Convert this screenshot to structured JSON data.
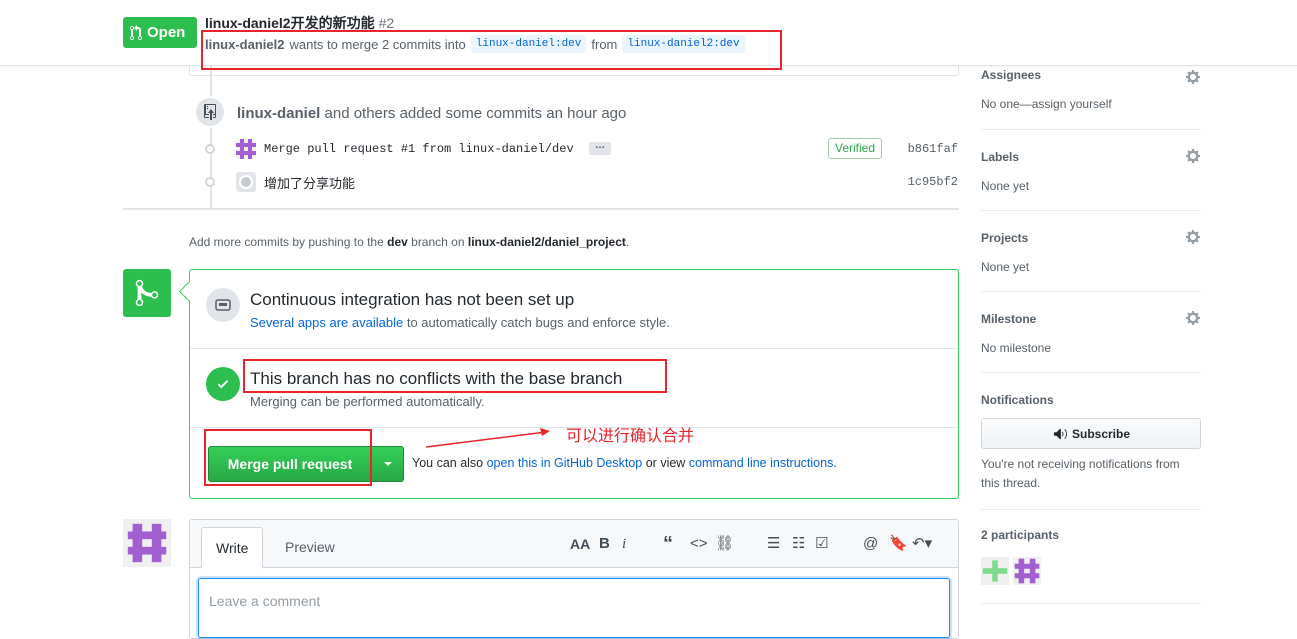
{
  "header": {
    "state": "Open",
    "title": "linux-daniel2开发的新功能",
    "number": "#2",
    "author": "linux-daniel2",
    "merge_text": "wants to merge 2 commits into",
    "base_branch": "linux-daniel:dev",
    "from_text": "from",
    "head_branch": "linux-daniel2:dev"
  },
  "timeline": {
    "summary_author": "linux-daniel",
    "summary_text": "and others added some commits an hour ago",
    "commits": [
      {
        "message": "Merge pull request #1 from linux-daniel/dev",
        "verified": "Verified",
        "sha": "b861faf",
        "ellipsis": "…"
      },
      {
        "message": "增加了分享功能",
        "sha": "1c95bf2"
      }
    ],
    "add_more_prefix": "Add more commits by pushing to the",
    "add_more_branch": "dev",
    "add_more_mid": "branch on",
    "add_more_repo": "linux-daniel2/daniel_project",
    "add_more_suffix": "."
  },
  "merge_box": {
    "ci_title": "Continuous integration has not been set up",
    "ci_link": "Several apps are available",
    "ci_text": "to automatically catch bugs and enforce style.",
    "conflict_title": "This branch has no conflicts with the base branch",
    "conflict_sub": "Merging can be performed automatically.",
    "merge_button": "Merge pull request",
    "alt_prefix": "You can also",
    "alt_link1": "open this in GitHub Desktop",
    "alt_mid": "or view",
    "alt_link2": "command line instructions",
    "alt_suffix": "."
  },
  "annotation": {
    "text": "可以进行确认合并",
    "color": "#e8242c"
  },
  "comment": {
    "tab_write": "Write",
    "tab_preview": "Preview",
    "placeholder": "Leave a comment"
  },
  "sidebar": {
    "assignees_label": "Assignees",
    "assignees_value": "No one—assign yourself",
    "labels_label": "Labels",
    "labels_value": "None yet",
    "projects_label": "Projects",
    "projects_value": "None yet",
    "milestone_label": "Milestone",
    "milestone_value": "No milestone",
    "notifications_label": "Notifications",
    "subscribe_button": "Subscribe",
    "notifications_note": "You're not receiving notifications from this thread.",
    "participants_label": "2 participants"
  },
  "colors": {
    "green": "#2cbe4e",
    "link": "#0366d6",
    "annotation_red": "#e8242c"
  }
}
